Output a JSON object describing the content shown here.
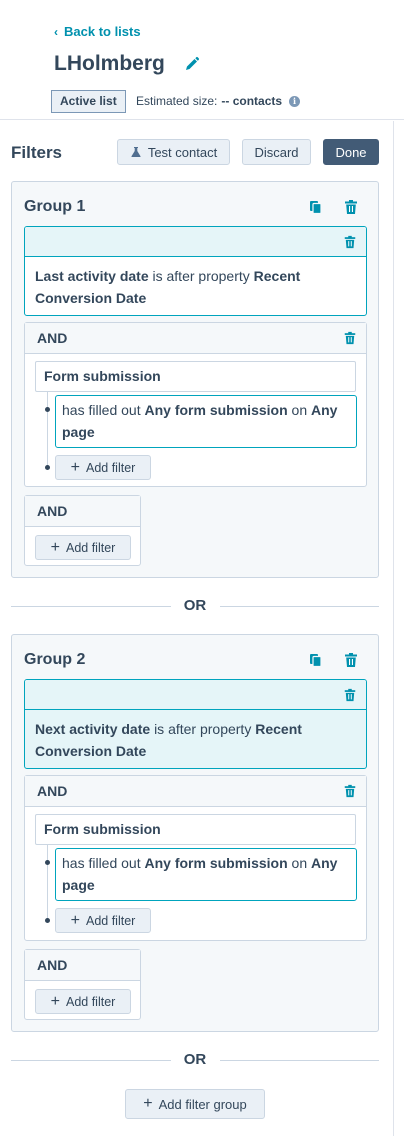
{
  "header": {
    "back_label": "Back to lists",
    "list_name": "LHolmberg",
    "badge": "Active list",
    "estimated_label": "Estimated size:",
    "estimated_value": "-- contacts",
    "info_glyph": "i"
  },
  "toolbar": {
    "title": "Filters",
    "test_contact": "Test contact",
    "discard": "Discard",
    "done": "Done"
  },
  "groups": [
    {
      "title": "Group 1",
      "filter": {
        "property": "Last activity date",
        "operator": "is after property",
        "value": "Recent Conversion Date"
      },
      "and_block": {
        "label": "AND",
        "form_label": "Form submission",
        "sub_filter": {
          "prefix": "has filled out",
          "form": "Any form submission",
          "on": "on",
          "page": "Any page"
        },
        "add_filter": "Add filter"
      },
      "and_small": {
        "label": "AND",
        "add_filter": "Add filter"
      }
    },
    {
      "title": "Group 2",
      "filter": {
        "property": "Next activity date",
        "operator": "is after property",
        "value": "Recent Conversion Date"
      },
      "and_block": {
        "label": "AND",
        "form_label": "Form submission",
        "sub_filter": {
          "prefix": "has filled out",
          "form": "Any form submission",
          "on": "on",
          "page": "Any page"
        },
        "add_filter": "Add filter"
      },
      "and_small": {
        "label": "AND",
        "add_filter": "Add filter"
      }
    }
  ],
  "or_label": "OR",
  "add_filter_group": "Add filter group",
  "colors": {
    "accent": "#0091ae",
    "border_teal": "#00a4bd",
    "done_button": "#425b76",
    "text": "#33475b"
  }
}
